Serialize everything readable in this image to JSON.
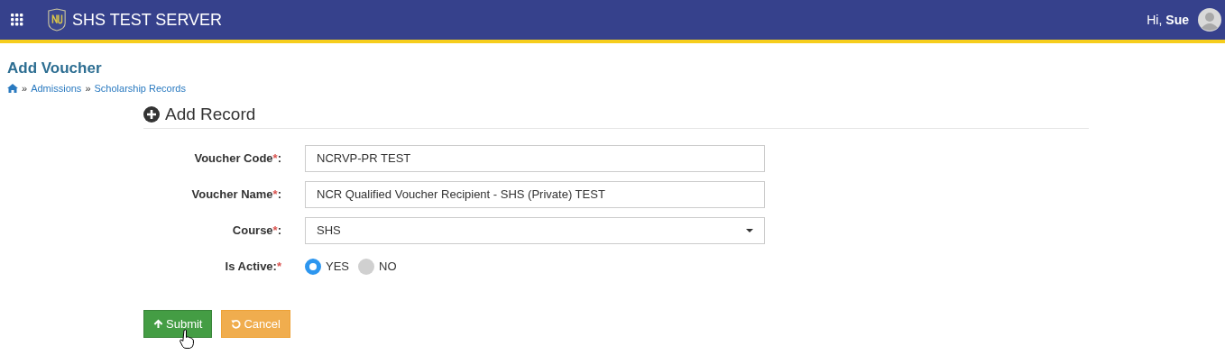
{
  "header": {
    "title": "SHS TEST SERVER",
    "greeting": "Hi,",
    "user": "Sue"
  },
  "page": {
    "title": "Add Voucher",
    "breadcrumb": [
      "Admissions",
      "Scholarship Records"
    ],
    "separator": "»"
  },
  "section": {
    "title": "Add Record"
  },
  "fields": [
    {
      "kind": "text",
      "label": [
        {
          "text": "Voucher Code",
          "kind": "plain"
        },
        {
          "text": "*",
          "kind": "required"
        },
        {
          "text": ":",
          "kind": "plain"
        }
      ],
      "value": "NCRVP-PR TEST"
    },
    {
      "kind": "text",
      "label": [
        {
          "text": "Voucher Name",
          "kind": "plain"
        },
        {
          "text": "*",
          "kind": "required"
        },
        {
          "text": ":",
          "kind": "plain"
        }
      ],
      "value": "NCR Qualified Voucher Recipient - SHS (Private) TEST"
    },
    {
      "kind": "select",
      "label": [
        {
          "text": "Course",
          "kind": "plain"
        },
        {
          "text": "*",
          "kind": "required"
        },
        {
          "text": ":",
          "kind": "plain"
        }
      ],
      "value": "SHS"
    },
    {
      "kind": "radio",
      "label": [
        {
          "text": "Is Active:",
          "kind": "plain"
        },
        {
          "text": "*",
          "kind": "required"
        }
      ],
      "options": [
        {
          "label": "YES",
          "selected": true
        },
        {
          "label": "NO",
          "selected": false
        }
      ]
    }
  ],
  "buttons": [
    {
      "kind": "submit",
      "label": "Submit"
    },
    {
      "kind": "cancel",
      "label": "Cancel"
    }
  ]
}
